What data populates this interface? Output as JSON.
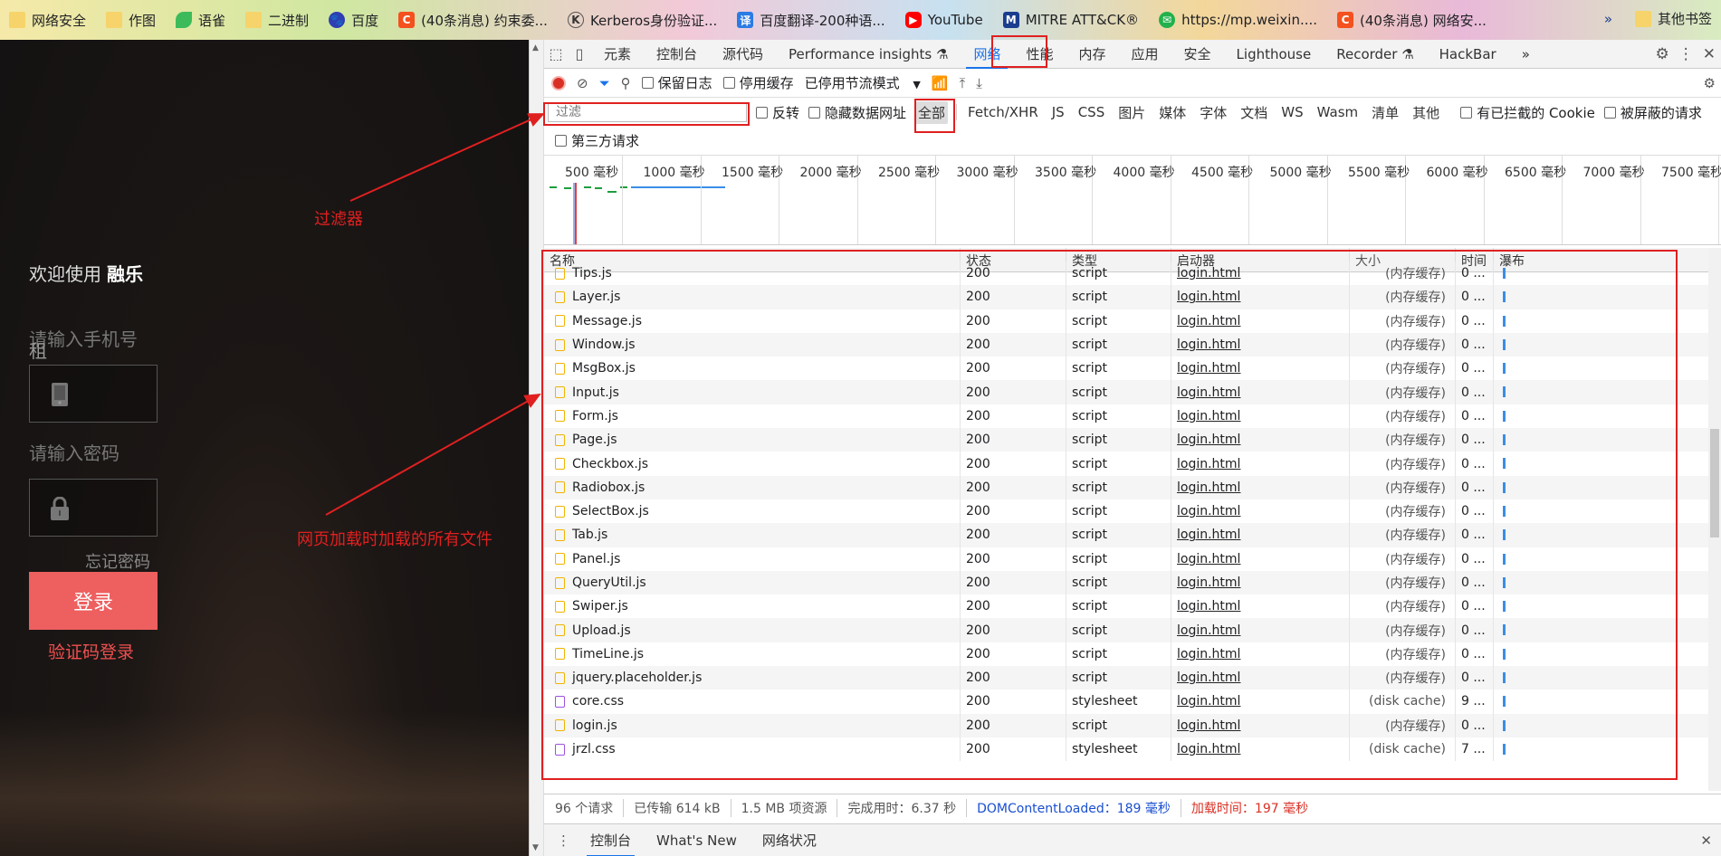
{
  "bookmarks": {
    "items": [
      {
        "label": "网络安全",
        "icon": "folder-icon"
      },
      {
        "label": "作图",
        "icon": "folder-icon"
      },
      {
        "label": "语雀",
        "icon": "yuque-icon"
      },
      {
        "label": "二进制",
        "icon": "folder-icon"
      },
      {
        "label": "百度",
        "icon": "baidu-icon"
      },
      {
        "label": "(40条消息) 约束委...",
        "icon": "csdn-icon"
      },
      {
        "label": "Kerberos身份验证...",
        "icon": "kerberos-icon"
      },
      {
        "label": "百度翻译-200种语...",
        "icon": "baidu-translate-icon"
      },
      {
        "label": "YouTube",
        "icon": "youtube-icon"
      },
      {
        "label": "MITRE ATT&CK®",
        "icon": "mitre-icon"
      },
      {
        "label": "https://mp.weixin....",
        "icon": "wechat-icon"
      },
      {
        "label": "(40条消息) 网络安...",
        "icon": "csdn-icon"
      }
    ],
    "more": "»",
    "other": "其他书签"
  },
  "login": {
    "welcome_prefix": "欢迎使用",
    "welcome_brand": "融乐",
    "phone_label": "请输入手机号",
    "phone_label_extra": "租",
    "password_label": "请输入密码",
    "forgot": "忘记密码",
    "login_button": "登录",
    "sms_login": "验证码登录"
  },
  "annotations": {
    "filter": "过滤器",
    "all_files": "网页加载时加载的所有文件"
  },
  "devtools": {
    "tabs": [
      "元素",
      "控制台",
      "源代码",
      "Performance insights ⚗",
      "网络",
      "性能",
      "内存",
      "应用",
      "安全",
      "Lighthouse",
      "Recorder ⚗",
      "HackBar"
    ],
    "active_tab": "网络",
    "tabs_more": "»",
    "toolbar": {
      "preserve_log": "保留日志",
      "disable_cache": "停用缓存",
      "throttling": "已停用节流模式"
    },
    "filter": {
      "placeholder": "过滤",
      "invert": "反转",
      "hide_data_urls": "隐藏数据网址",
      "types": [
        "全部",
        "Fetch/XHR",
        "JS",
        "CSS",
        "图片",
        "媒体",
        "字体",
        "文档",
        "WS",
        "Wasm",
        "清单",
        "其他"
      ],
      "selected_type": "全部",
      "blocked_cookies": "有已拦截的 Cookie",
      "blocked_requests": "被屏蔽的请求",
      "third_party": "第三方请求"
    },
    "overview_ticks": [
      "500 毫秒",
      "1000 毫秒",
      "1500 毫秒",
      "2000 毫秒",
      "2500 毫秒",
      "3000 毫秒",
      "3500 毫秒",
      "4000 毫秒",
      "4500 毫秒",
      "5000 毫秒",
      "5500 毫秒",
      "6000 毫秒",
      "6500 毫秒",
      "7000 毫秒",
      "7500 毫秒"
    ],
    "columns": {
      "name": "名称",
      "status": "状态",
      "type": "类型",
      "initiator": "启动器",
      "size": "大小",
      "time": "时间",
      "waterfall": "瀑布"
    },
    "rows": [
      {
        "name": "Tips.js",
        "status": "200",
        "type": "script",
        "initiator": "login.html",
        "size": "(内存缓存)",
        "time": "0 ...",
        "kind": "js"
      },
      {
        "name": "Layer.js",
        "status": "200",
        "type": "script",
        "initiator": "login.html",
        "size": "(内存缓存)",
        "time": "0 ...",
        "kind": "js"
      },
      {
        "name": "Message.js",
        "status": "200",
        "type": "script",
        "initiator": "login.html",
        "size": "(内存缓存)",
        "time": "0 ...",
        "kind": "js"
      },
      {
        "name": "Window.js",
        "status": "200",
        "type": "script",
        "initiator": "login.html",
        "size": "(内存缓存)",
        "time": "0 ...",
        "kind": "js"
      },
      {
        "name": "MsgBox.js",
        "status": "200",
        "type": "script",
        "initiator": "login.html",
        "size": "(内存缓存)",
        "time": "0 ...",
        "kind": "js"
      },
      {
        "name": "Input.js",
        "status": "200",
        "type": "script",
        "initiator": "login.html",
        "size": "(内存缓存)",
        "time": "0 ...",
        "kind": "js"
      },
      {
        "name": "Form.js",
        "status": "200",
        "type": "script",
        "initiator": "login.html",
        "size": "(内存缓存)",
        "time": "0 ...",
        "kind": "js"
      },
      {
        "name": "Page.js",
        "status": "200",
        "type": "script",
        "initiator": "login.html",
        "size": "(内存缓存)",
        "time": "0 ...",
        "kind": "js"
      },
      {
        "name": "Checkbox.js",
        "status": "200",
        "type": "script",
        "initiator": "login.html",
        "size": "(内存缓存)",
        "time": "0 ...",
        "kind": "js"
      },
      {
        "name": "Radiobox.js",
        "status": "200",
        "type": "script",
        "initiator": "login.html",
        "size": "(内存缓存)",
        "time": "0 ...",
        "kind": "js"
      },
      {
        "name": "SelectBox.js",
        "status": "200",
        "type": "script",
        "initiator": "login.html",
        "size": "(内存缓存)",
        "time": "0 ...",
        "kind": "js"
      },
      {
        "name": "Tab.js",
        "status": "200",
        "type": "script",
        "initiator": "login.html",
        "size": "(内存缓存)",
        "time": "0 ...",
        "kind": "js"
      },
      {
        "name": "Panel.js",
        "status": "200",
        "type": "script",
        "initiator": "login.html",
        "size": "(内存缓存)",
        "time": "0 ...",
        "kind": "js"
      },
      {
        "name": "QueryUtil.js",
        "status": "200",
        "type": "script",
        "initiator": "login.html",
        "size": "(内存缓存)",
        "time": "0 ...",
        "kind": "js"
      },
      {
        "name": "Swiper.js",
        "status": "200",
        "type": "script",
        "initiator": "login.html",
        "size": "(内存缓存)",
        "time": "0 ...",
        "kind": "js"
      },
      {
        "name": "Upload.js",
        "status": "200",
        "type": "script",
        "initiator": "login.html",
        "size": "(内存缓存)",
        "time": "0 ...",
        "kind": "js"
      },
      {
        "name": "TimeLine.js",
        "status": "200",
        "type": "script",
        "initiator": "login.html",
        "size": "(内存缓存)",
        "time": "0 ...",
        "kind": "js"
      },
      {
        "name": "jquery.placeholder.js",
        "status": "200",
        "type": "script",
        "initiator": "login.html",
        "size": "(内存缓存)",
        "time": "0 ...",
        "kind": "js"
      },
      {
        "name": "core.css",
        "status": "200",
        "type": "stylesheet",
        "initiator": "login.html",
        "size": "(disk cache)",
        "time": "9 ...",
        "kind": "css"
      },
      {
        "name": "login.js",
        "status": "200",
        "type": "script",
        "initiator": "login.html",
        "size": "(内存缓存)",
        "time": "0 ...",
        "kind": "js"
      },
      {
        "name": "jrzl.css",
        "status": "200",
        "type": "stylesheet",
        "initiator": "login.html",
        "size": "(disk cache)",
        "time": "7 ...",
        "kind": "css"
      }
    ],
    "status_bar": {
      "requests": "96 个请求",
      "transferred": "已传输 614 kB",
      "resources": "1.5 MB 项资源",
      "finish": "完成用时：6.37 秒",
      "dcl": "DOMContentLoaded：189 毫秒",
      "load": "加载时间：197 毫秒"
    },
    "drawer_tabs": [
      "控制台",
      "What's New",
      "网络状况"
    ],
    "drawer_active": "控制台",
    "colors": {
      "accent": "#1a73e8",
      "annotation": "#e02020",
      "login_button": "#ee5f5f"
    }
  }
}
